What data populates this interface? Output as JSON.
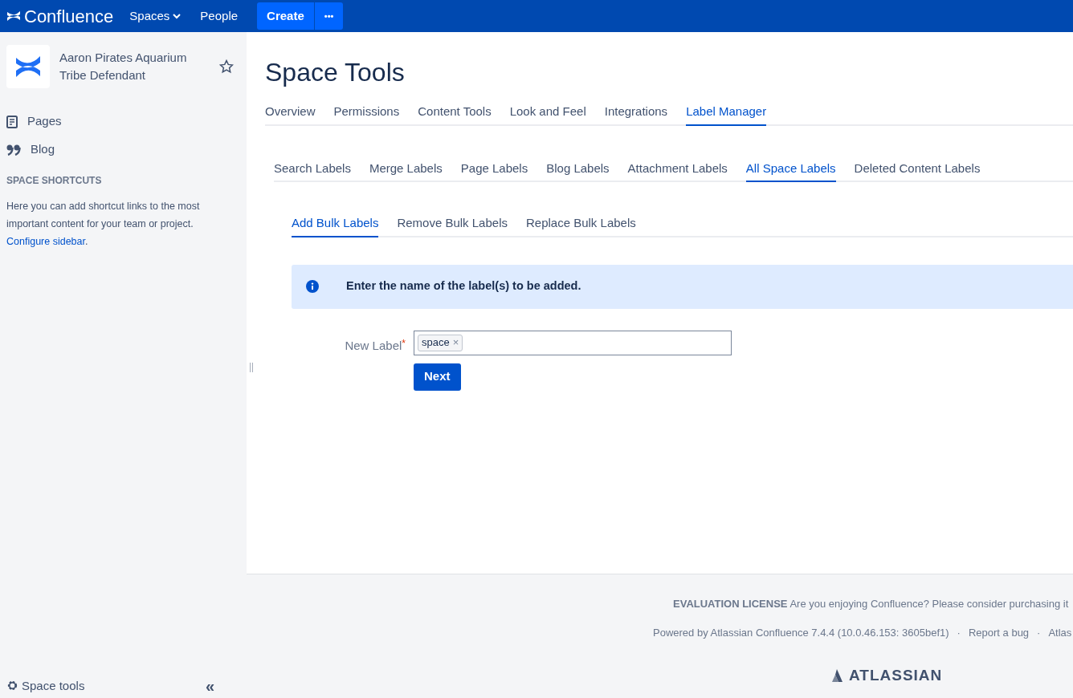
{
  "top_nav": {
    "logo": "Confluence",
    "items": [
      {
        "label": "Spaces",
        "kind": "dropdown"
      },
      {
        "label": "People",
        "kind": "link"
      }
    ],
    "create_button": "Create",
    "more_button": "•••"
  },
  "sidebar": {
    "space_name": "Aaron Pirates Aquarium Tribe Defendant",
    "starred": false,
    "items": [
      {
        "label": "Pages",
        "kind": "pages"
      },
      {
        "label": "Blog",
        "kind": "blog"
      }
    ],
    "shortcuts_heading": "SPACE SHORTCUTS",
    "shortcuts_text": "Here you can add shortcut links to the most important content for your team or project.",
    "configure_link": "Configure sidebar",
    "configure_suffix": ".",
    "space_tools": "Space tools",
    "collapse": "«"
  },
  "page_title": "Space Tools",
  "tabs": [
    {
      "label": "Overview",
      "selected": false
    },
    {
      "label": "Permissions",
      "selected": false
    },
    {
      "label": "Content Tools",
      "selected": false
    },
    {
      "label": "Look and Feel",
      "selected": false
    },
    {
      "label": "Integrations",
      "selected": false
    },
    {
      "label": "Label Manager",
      "selected": true
    }
  ],
  "label_tabs": [
    {
      "label": "Search Labels",
      "selected": false
    },
    {
      "label": "Merge Labels",
      "selected": false
    },
    {
      "label": "Page Labels",
      "selected": false
    },
    {
      "label": "Blog Labels",
      "selected": false
    },
    {
      "label": "Attachment Labels",
      "selected": false
    },
    {
      "label": "All Space Labels",
      "selected": true
    },
    {
      "label": "Deleted Content Labels",
      "selected": false
    }
  ],
  "bulk_tabs": [
    {
      "label": "Add Bulk Labels",
      "selected": true
    },
    {
      "label": "Remove Bulk Labels",
      "selected": false
    },
    {
      "label": "Replace Bulk Labels",
      "selected": false
    }
  ],
  "info_message": "Enter the name of the label(s) to be added.",
  "form": {
    "label": "New Label",
    "required_mark": "*",
    "tags": [
      {
        "label": "space",
        "remove": "×"
      }
    ],
    "button": "Next"
  },
  "footer": {
    "license": "**EVALUATION LICENSE** Are you enjoying Confluence? Please consider purchasing it",
    "powered_by": "Powered by Atlassian Confluence 7.4.4 (10.0.46.153: 3605bef1)",
    "links": [
      "Report a bug",
      "Atlas"
    ],
    "separator": "·",
    "logo": "ATLASSIAN"
  }
}
